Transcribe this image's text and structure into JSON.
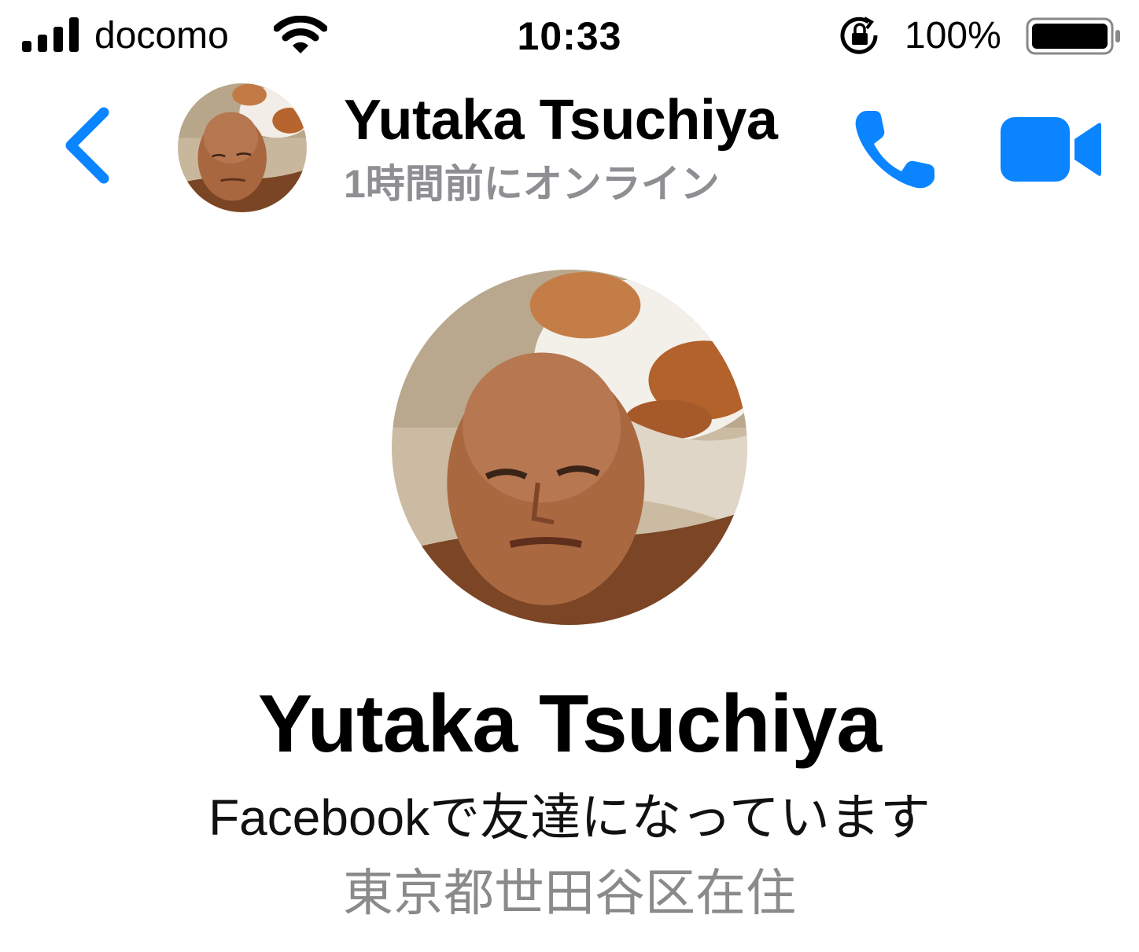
{
  "status_bar": {
    "carrier": "docomo",
    "time": "10:33",
    "battery_percent": "100%",
    "battery_level": 1.0,
    "icons": [
      "signal-bars-icon",
      "wifi-icon",
      "rotation-lock-icon",
      "battery-icon"
    ]
  },
  "header": {
    "contact_name": "Yutaka Tsuchiya",
    "last_seen": "1時間前にオンライン",
    "icons": [
      "chevron-left-icon",
      "phone-icon",
      "video-camera-icon"
    ],
    "accent_color": "#0a84ff"
  },
  "profile": {
    "name": "Yutaka Tsuchiya",
    "friend_status": "Facebookで友達になっています",
    "location": "東京都世田谷区在住"
  },
  "colors": {
    "accent": "#0a84ff",
    "secondary_text": "#8e8e93",
    "background": "#ffffff"
  }
}
